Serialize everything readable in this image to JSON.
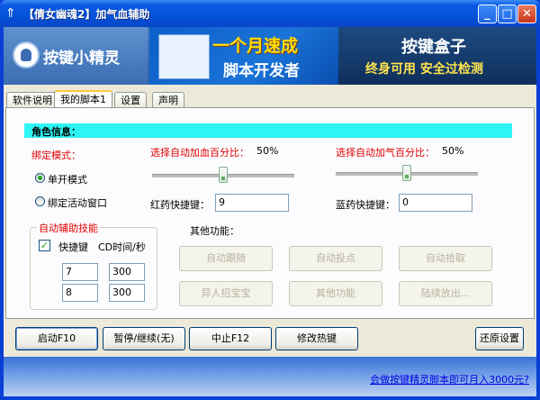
{
  "window": {
    "title": "【倩女幽魂2】加气血辅助",
    "min": "_",
    "max": "□",
    "close": "✕"
  },
  "banner": {
    "logo_text": "按键小精灵",
    "ad1_line1": "一个月速成",
    "ad1_line2": "脚本开发者",
    "ad2_line1": "按键盒子",
    "ad2_line2": "终身可用 安全过检测"
  },
  "tabs": [
    "软件说明",
    "我的脚本1",
    "设置",
    "声明"
  ],
  "role": {
    "title": "角色信息："
  },
  "bind": {
    "label": "绑定模式：",
    "options": [
      "单开模式",
      "绑定活动窗口"
    ],
    "selected": 0
  },
  "hp": {
    "label": "选择自动加血百分比：",
    "percent_text": "50%",
    "value": 0.5,
    "hotkey_label": "红药快捷键：",
    "hotkey_value": "9"
  },
  "mp": {
    "label": "选择自动加气百分比：",
    "percent_text": "50%",
    "value": 0.5,
    "hotkey_label": "蓝药快捷键：",
    "hotkey_value": "0"
  },
  "skills": {
    "title": "自动辅助技能",
    "col_hotkey": "快捷键",
    "col_cd": "CD时间/秒",
    "checked": true,
    "rows": [
      {
        "key": "7",
        "cd": "300"
      },
      {
        "key": "8",
        "cd": "300"
      }
    ]
  },
  "other": {
    "title": "其他功能：",
    "buttons": [
      "自动跟随",
      "自动投点",
      "自动拾取",
      "异人招宝宝",
      "其他功能",
      "陆续放出..."
    ]
  },
  "actions": {
    "start": "启动F10",
    "pause": "暂停/继续(无)",
    "stop": "中止F12",
    "hotkey": "修改热键",
    "restore": "还原设置"
  },
  "footer": {
    "link": "会做按键精灵脚本即可月入3000元?"
  },
  "colors": {
    "role_bar": "#2ef4f4",
    "label_red": "#e00000",
    "titlebar": "#0553d8"
  }
}
